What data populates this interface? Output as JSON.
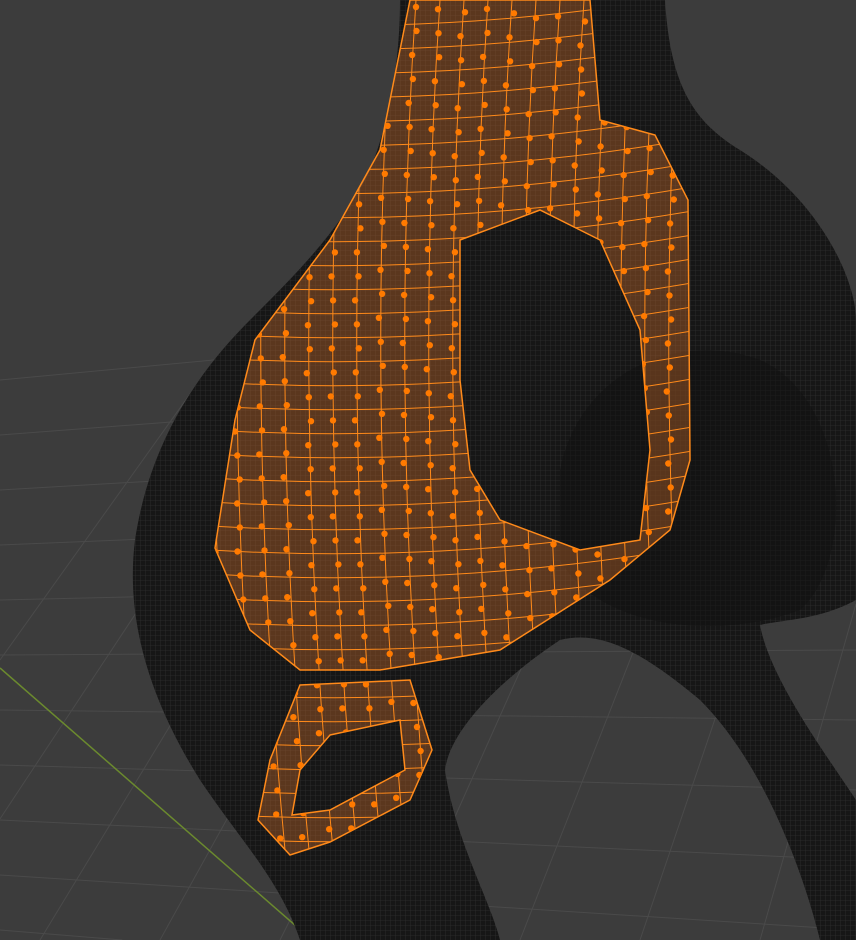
{
  "viewport": {
    "mode": "edit-mode-3d-viewport",
    "colors": {
      "background": "#3c3c3c",
      "grid_line": "#4a4a4a",
      "axis_y": "#6b8a2e",
      "mesh_dark": "#161616",
      "mesh_wire": "#2c2c2c",
      "selection_wire": "#ff8a1a",
      "selection_fill": "#c46a2a",
      "vertex": "#ff7a00"
    },
    "icons": {
      "vertex": "vertex-dot-icon"
    }
  }
}
